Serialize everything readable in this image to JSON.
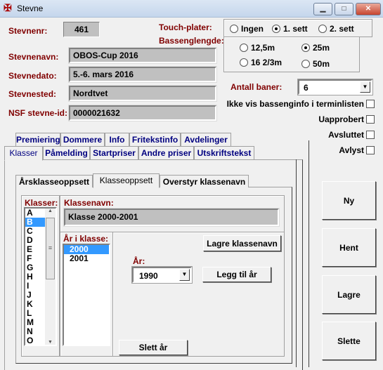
{
  "window": {
    "title": "Stevne",
    "icon": "app-logo-icon",
    "controls": {
      "minimize": "minimize-icon",
      "maximize": "maximize-icon",
      "close": "close-icon"
    }
  },
  "fields": {
    "stevnenr": {
      "label": "Stevnenr:",
      "value": "461"
    },
    "stevnenavn": {
      "label": "Stevnenavn:",
      "value": "OBOS-Cup 2016"
    },
    "stevnedato": {
      "label": "Stevnedato:",
      "value": "5.-6. mars 2016"
    },
    "stevnested": {
      "label": "Stevnested:",
      "value": "Nordtvet"
    },
    "nsf_id": {
      "label": "NSF stevne-id:",
      "value": "0000021632"
    }
  },
  "touch": {
    "label": "Touch-plater:",
    "options": [
      "Ingen",
      "1. sett",
      "2. sett"
    ],
    "selected": "1. sett"
  },
  "basseng": {
    "label": "Bassenglengde:",
    "options": [
      "12,5m",
      "25m",
      "16 2/3m",
      "50m"
    ],
    "selected": "25m"
  },
  "baner": {
    "label": "Antall baner:",
    "value": "6"
  },
  "checks": [
    {
      "label": "Ikke vis bassenginfo i terminlisten",
      "checked": false
    },
    {
      "label": "Uapprobert",
      "checked": false
    },
    {
      "label": "Avsluttet",
      "checked": false
    },
    {
      "label": "Avlyst",
      "checked": false
    }
  ],
  "tabs_row1": [
    "Premiering",
    "Dommere",
    "Info",
    "Fritekstinfo",
    "Avdelinger"
  ],
  "tabs_row2": [
    "Klasser",
    "Påmelding",
    "Startpriser",
    "Andre priser",
    "Utskriftstekst"
  ],
  "active_tab": "Klasser",
  "subtabs": [
    "Årsklasseoppsett",
    "Klasseoppsett",
    "Overstyr klassenavn"
  ],
  "active_subtab": "Klasseoppsett",
  "klasser": {
    "label": "Klasser:",
    "items": [
      "A",
      "B",
      "C",
      "D",
      "E",
      "F",
      "G",
      "H",
      "I",
      "J",
      "K",
      "L",
      "M",
      "N",
      "O"
    ],
    "selected": "B"
  },
  "klassenavn": {
    "label": "Klassenavn:",
    "value": "Klasse 2000-2001"
  },
  "ar_i_klasse": {
    "label": "År i klasse:",
    "items": [
      "2000",
      "2001"
    ],
    "selected": "2000"
  },
  "ar": {
    "label": "År:",
    "value": "1990"
  },
  "buttons": {
    "lagre_klassenavn": "Lagre klassenavn",
    "legg_til": "Legg til år",
    "slett": "Slett år",
    "ny": "Ny",
    "hent": "Hent",
    "lagre": "Lagre",
    "slette": "Slette"
  }
}
